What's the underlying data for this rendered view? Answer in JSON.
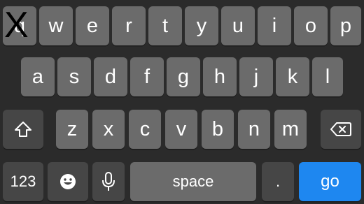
{
  "keyboard": {
    "row1": [
      "q",
      "w",
      "e",
      "r",
      "t",
      "y",
      "u",
      "i",
      "o",
      "p"
    ],
    "row2": [
      "a",
      "s",
      "d",
      "f",
      "g",
      "h",
      "j",
      "k",
      "l"
    ],
    "row3": [
      "z",
      "x",
      "c",
      "v",
      "b",
      "n",
      "m"
    ],
    "numbers_label": "123",
    "space_label": "space",
    "period_label": ".",
    "go_label": "go",
    "overlay_mark": "X",
    "icons": {
      "shift": "shift-icon",
      "backspace": "backspace-icon",
      "emoji": "emoji-icon",
      "mic": "microphone-icon"
    },
    "colors": {
      "background": "#2b2b2b",
      "key": "#6b6b6b",
      "modifier_key": "#464646",
      "go_key": "#1e87f0",
      "text": "#ffffff"
    }
  }
}
